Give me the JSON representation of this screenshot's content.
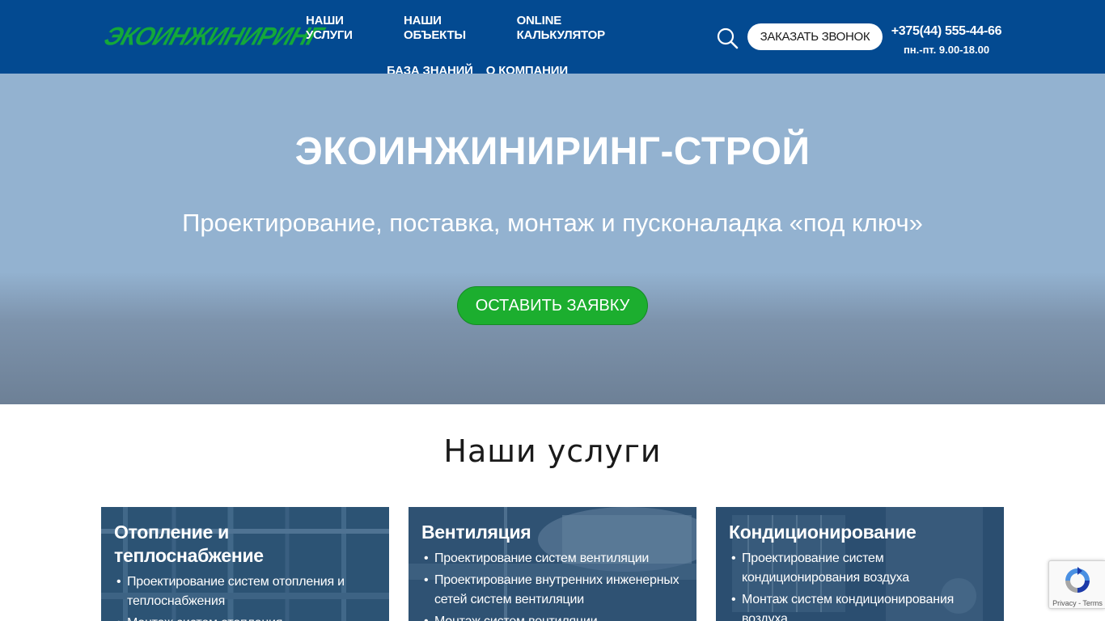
{
  "header": {
    "logo_text": "ЭКОИНЖИНИРИНГ",
    "nav_row1": [
      "НАШИ УСЛУГИ",
      "НАШИ ОБЪЕКТЫ",
      "ONLINE КАЛЬКУЛЯТОР"
    ],
    "nav_row2": [
      "БАЗА ЗНАНИЙ",
      "О КОМПАНИИ"
    ],
    "call_button": "ЗАКАЗАТЬ ЗВОНОК",
    "phone": "+375(44) 555-44-66",
    "hours": "пн.-пт. 9.00-18.00",
    "colors": {
      "background": "#034a91",
      "logo": "#14a83a"
    }
  },
  "hero": {
    "title": "ЭКОИНЖИНИРИНГ-СТРОЙ",
    "subtitle": "Проектирование, поставка, монтаж и пусконаладка «под ключ»",
    "cta_button": "ОСТАВИТЬ ЗАЯВКУ",
    "colors": {
      "cta": "#1cae2f"
    }
  },
  "services": {
    "title": "Наши услуги",
    "cards": [
      {
        "title": "Отопление и теплоснабжение",
        "items": [
          "Проектирование систем отопления и теплоснабжения",
          "Монтаж систем отопления"
        ]
      },
      {
        "title": "Вентиляция",
        "items": [
          "Проектирование систем вентиляции",
          "Проектирование внутренних инженерных сетей систем вентиляции",
          "Монтаж систем вентиляции"
        ]
      },
      {
        "title": "Кондиционирование",
        "items": [
          "Проектирование систем кондиционирования воздуха",
          "Монтаж систем кондиционирования воздуха"
        ]
      }
    ]
  },
  "recaptcha": {
    "text": "Privacy - Terms"
  }
}
